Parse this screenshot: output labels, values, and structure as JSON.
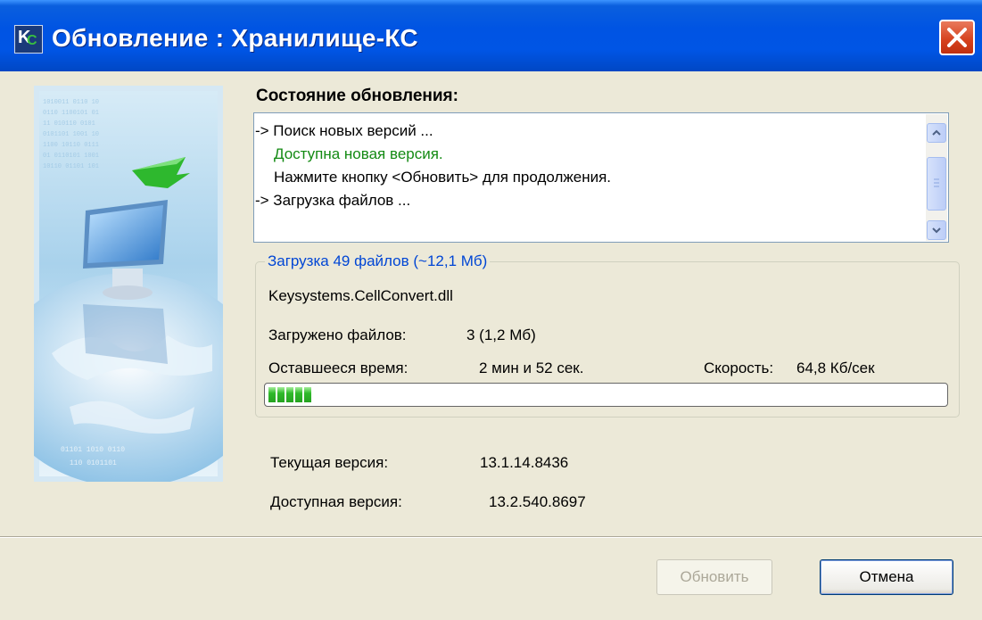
{
  "window": {
    "title": "Обновление : Хранилище-КС",
    "app_icon": "ks-app-icon",
    "close_icon": "close-icon"
  },
  "status": {
    "label": "Состояние обновления:",
    "log": [
      {
        "text": "-> Поиск новых версий ...",
        "color": "#000000"
      },
      {
        "text": "Доступна новая версия.",
        "color": "#138a13"
      },
      {
        "text": "Нажмите кнопку <Обновить> для продолжения.",
        "color": "#000000"
      },
      {
        "text": "-> Загрузка файлов ...",
        "color": "#000000"
      }
    ]
  },
  "download": {
    "group_title": "Загрузка 49 файлов (~12,1 Мб)",
    "current_file": "Keysystems.CellConvert.dll",
    "loaded_label": "Загружено файлов:",
    "loaded_value": "3  (1,2 Мб)",
    "remaining_label": "Оставшееся время:",
    "remaining_value": "2 мин и 52 сек.",
    "speed_label": "Скорость:",
    "speed_value": "64,8 Кб/сек",
    "progress_fraction": 0.06
  },
  "versions": {
    "current_label": "Текущая версия:",
    "current_value": "13.1.14.8436",
    "available_label": "Доступная версия:",
    "available_value": "13.2.540.8697"
  },
  "buttons": {
    "update": "Обновить",
    "cancel": "Отмена"
  },
  "colors": {
    "titlebar": "#0054e3",
    "group_title": "#0046d5",
    "progress": "#2fba2a",
    "close": "#d5401c"
  }
}
